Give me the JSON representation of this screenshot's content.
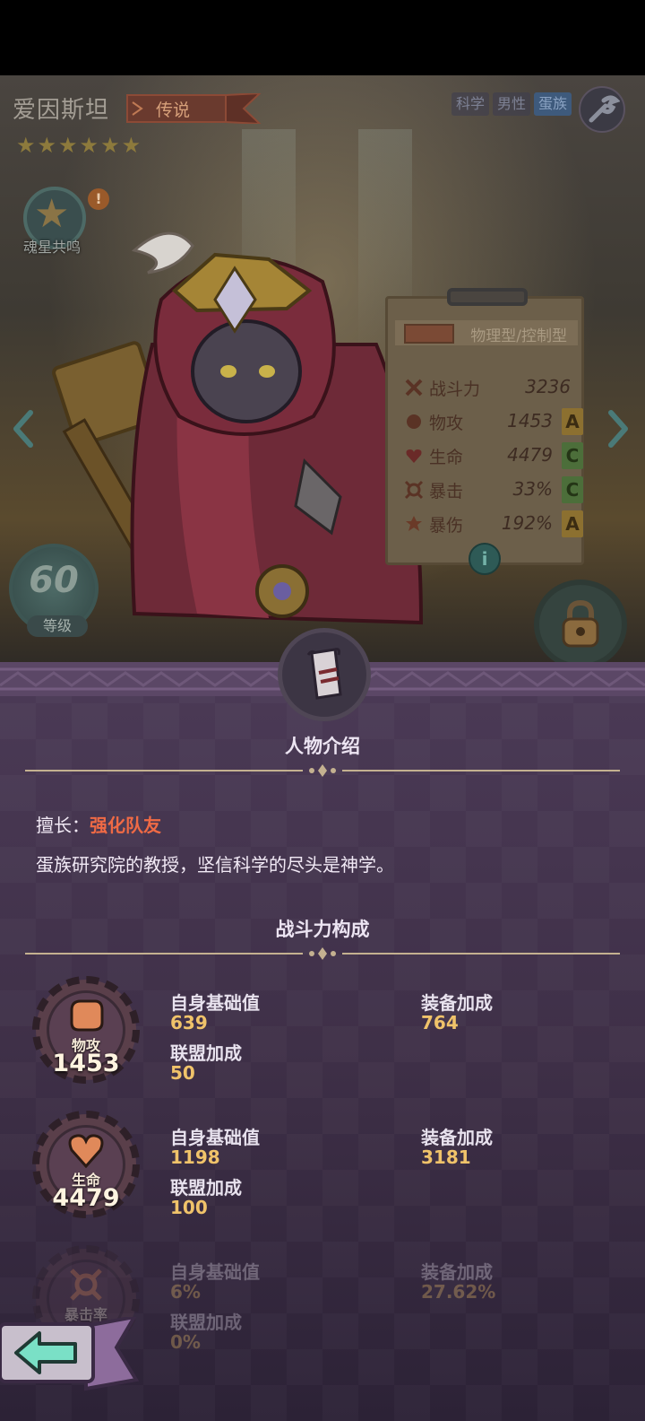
{
  "hero": {
    "name": "爱因斯坦",
    "rarity": "传说",
    "stars": 6,
    "tags": [
      "科学",
      "男性",
      "蛋族"
    ]
  },
  "resonance": {
    "label": "魂星共鸣",
    "alert": "!"
  },
  "level": {
    "value": "60",
    "label": "等级"
  },
  "stats_board": {
    "type": "物理型/控制型",
    "rows": [
      {
        "icon": "combat-power-icon",
        "label": "战斗力",
        "value": "3236",
        "grade": ""
      },
      {
        "icon": "fist-icon",
        "label": "物攻",
        "value": "1453",
        "grade": "A"
      },
      {
        "icon": "heart-icon",
        "label": "生命",
        "value": "4479",
        "grade": "C"
      },
      {
        "icon": "crit-icon",
        "label": "暴击",
        "value": "33%",
        "grade": "C"
      },
      {
        "icon": "crit-damage-icon",
        "label": "暴伤",
        "value": "192%",
        "grade": "A"
      }
    ],
    "info": "i"
  },
  "profile": {
    "title": "人物介绍",
    "specialty_label": "擅长：",
    "specialty_value": "强化队友",
    "description": "蛋族研究院的教授，坚信科学的尽头是神学。"
  },
  "power": {
    "title": "战斗力构成",
    "items": [
      {
        "name": "物攻",
        "value": "1453",
        "icon": "fist-icon",
        "base_label": "自身基础值",
        "base": "639",
        "equip_label": "装备加成",
        "equip": "764",
        "alliance_label": "联盟加成",
        "alliance": "50"
      },
      {
        "name": "生命",
        "value": "4479",
        "icon": "heart-icon",
        "base_label": "自身基础值",
        "base": "1198",
        "equip_label": "装备加成",
        "equip": "3181",
        "alliance_label": "联盟加成",
        "alliance": "100"
      },
      {
        "name": "暴击率",
        "value": "",
        "icon": "crit-icon",
        "base_label": "自身基础值",
        "base": "6%",
        "equip_label": "装备加成",
        "equip": "27.62%",
        "alliance_label": "联盟加成",
        "alliance": "0%"
      }
    ]
  },
  "colors": {
    "accent_orange": "#ef6a45",
    "value_gold": "#f0c36a",
    "panel_purple": "#4b3a56",
    "grade_a": "#8c7030",
    "grade_c": "#4c6e3a"
  }
}
